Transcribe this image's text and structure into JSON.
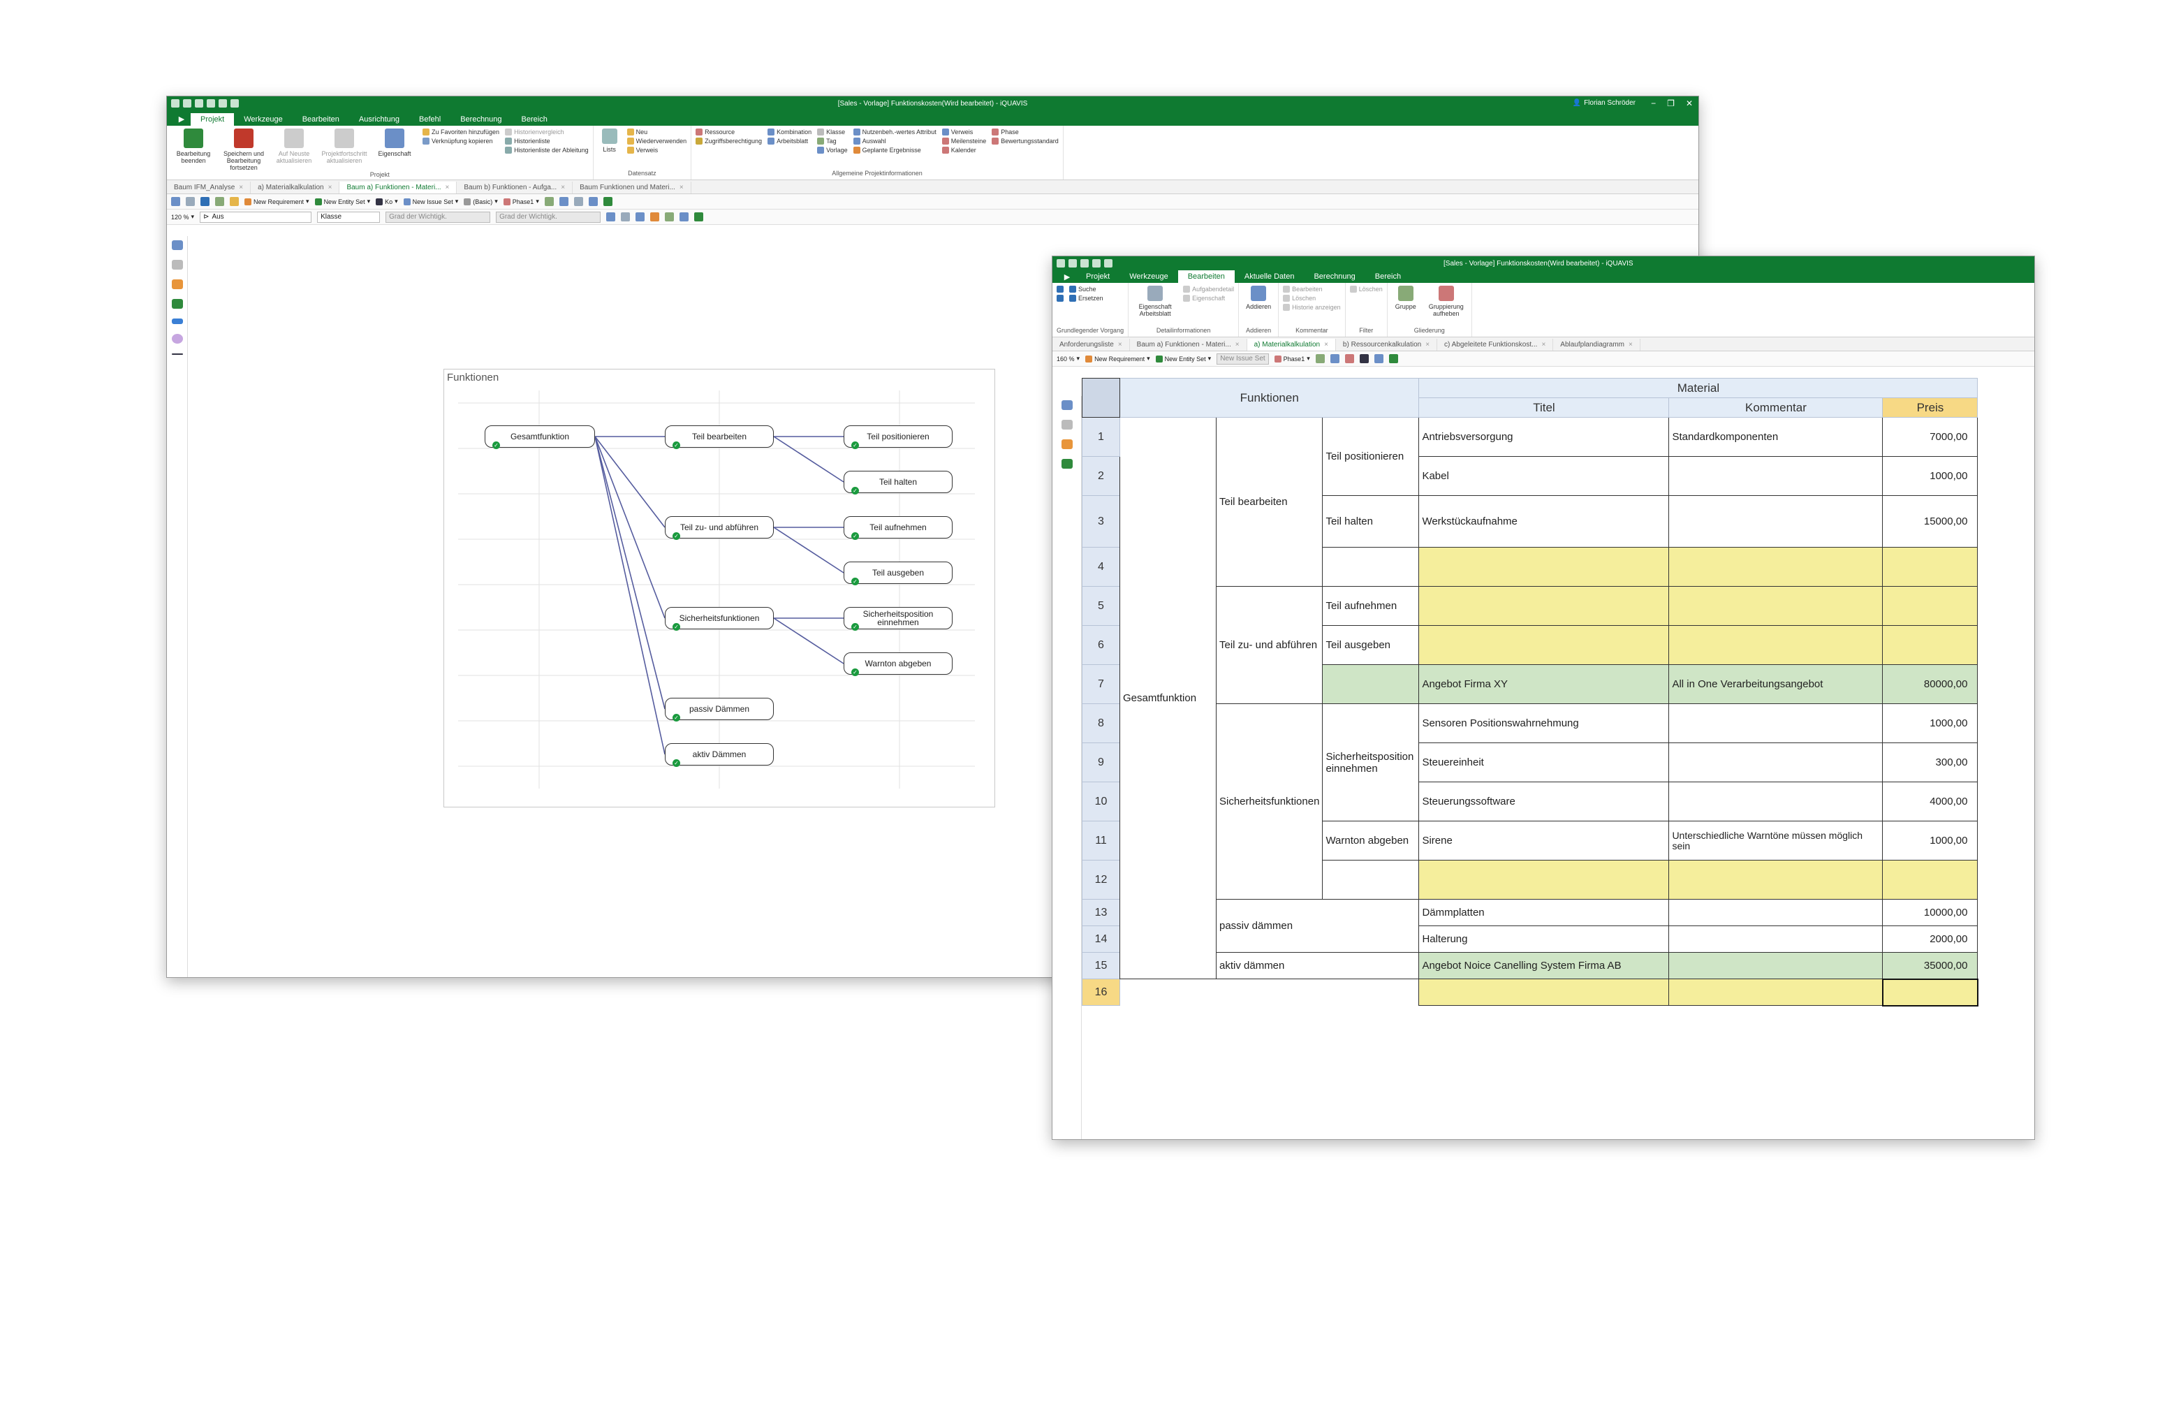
{
  "window1": {
    "title": "[Sales - Vorlage] Funktionskosten(Wird bearbeitet) - iQUAVIS",
    "user": "Florian Schröder",
    "menu": [
      "Projekt",
      "Werkzeuge",
      "Bearbeiten",
      "Ausrichtung",
      "Befehl",
      "Berechnung",
      "Bereich"
    ],
    "active_menu": "Projekt",
    "ribbon": {
      "big_buttons": [
        "Bearbeitung beenden",
        "Speichern und Bearbeitung fortsetzen",
        "Auf Neuste aktualisieren",
        "Projektfortschritt aktualisieren",
        "Eigenschaft"
      ],
      "group_projekt": "Projekt",
      "col1": [
        "Zu Favoriten hinzufügen",
        "Verknüpfung kopieren"
      ],
      "col2": [
        "Historienvergleich",
        "Historienliste",
        "Historienliste der Ableitung"
      ],
      "lists": "Lists",
      "col3": [
        "Neu",
        "Wiederverwenden",
        "Verweis"
      ],
      "group_datensatz": "Datensatz",
      "col4": [
        "Ressource",
        "Zugriffsberechtigung"
      ],
      "col5": [
        "Kombination",
        "Arbeitsblatt"
      ],
      "col6": [
        "Klasse",
        "Tag",
        "Vorlage"
      ],
      "col7": [
        "Nutzenbeh.-wertes Attribut",
        "Auswahl",
        "Geplante Ergebnisse"
      ],
      "col8": [
        "Verweis",
        "Meilensteine",
        "Kalender"
      ],
      "col9": [
        "Phase",
        "Bewertungsstandard"
      ],
      "group_allg": "Allgemeine Projektinformationen"
    },
    "tabs": [
      "Baum IFM_Analyse",
      "a) Materialkalkulation",
      "Baum a) Funktionen - Materi...",
      "Baum b) Funktionen - Aufga...",
      "Baum Funktionen und Materi..."
    ],
    "active_tab": 2,
    "toolbar1": {
      "req": "New Requirement",
      "entity": "New Entity Set",
      "k": "Ko",
      "issue": "New Issue Set",
      "basic": "(Basic)",
      "phase": "Phase1"
    },
    "toolbar2": {
      "zoom": "120 %",
      "aus": "Aus",
      "klasse": "Klasse",
      "grad1": "Grad der Wichtigk.",
      "grad2": "Grad der Wichtigk."
    },
    "diagram": {
      "title": "Funktionen",
      "nodes": {
        "gesamt": "Gesamtfunktion",
        "bearb": "Teil bearbeiten",
        "zuab": "Teil zu- und abführen",
        "sicher": "Sicherheitsfunktionen",
        "passiv": "passiv Dämmen",
        "aktiv": "aktiv Dämmen",
        "pos": "Teil positionieren",
        "halten": "Teil halten",
        "aufn": "Teil aufnehmen",
        "ausg": "Teil ausgeben",
        "sipos": "Sicherheitsposition einnehmen",
        "warn": "Warnton abgeben"
      }
    }
  },
  "window2": {
    "title": "[Sales - Vorlage] Funktionskosten(Wird bearbeitet) - iQUAVIS",
    "menu": [
      "Projekt",
      "Werkzeuge",
      "Bearbeiten",
      "Aktuelle Daten",
      "Berechnung",
      "Bereich"
    ],
    "active_menu": "Bearbeiten",
    "ribbon": {
      "g1_items": [
        "Suche",
        "Ersetzen"
      ],
      "g1_label": "Grundlegender Vorgang",
      "g2_big": "Eigenschaft Arbeitsblatt",
      "g2_items": [
        "Aufgabendetail",
        "Eigenschaft"
      ],
      "g2_label": "Detailinformationen",
      "g3_big": "Addieren",
      "g3_label": "Addieren",
      "g4_items": [
        "Bearbeiten",
        "Löschen",
        "Historie anzeigen"
      ],
      "g4_label": "Kommentar",
      "g5_items": [
        "Löschen"
      ],
      "g5_label": "Filter",
      "g6_big1": "Gruppe",
      "g6_big2": "Gruppierung aufheben",
      "g6_label": "Gliederung"
    },
    "tabs": [
      "Anforderungsliste",
      "Baum a) Funktionen - Materi...",
      "a) Materialkalkulation",
      "b) Ressourcenkalkulation",
      "c) Abgeleitete Funktionskost...",
      "Ablaufplandiagramm"
    ],
    "active_tab": 2,
    "toolbar": {
      "zoom": "160 %",
      "req": "New Requirement",
      "entity": "New Entity Set",
      "issue": "New Issue Set",
      "phase": "Phase1"
    },
    "grid": {
      "h_funktionen": "Funktionen",
      "h_material": "Material",
      "h_titel": "Titel",
      "h_kommentar": "Kommentar",
      "h_preis": "Preis",
      "f1": "Gesamtfunktion",
      "f2": [
        "Teil bearbeiten",
        "Teil zu- und abführen",
        "Sicherheitsfunktionen",
        "passiv dämmen",
        "aktiv dämmen"
      ],
      "f3": [
        "Teil positionieren",
        "Teil halten",
        "Teil aufnehmen",
        "Teil ausgeben",
        "Sicherheitsposition einnehmen",
        "Warnton abgeben"
      ],
      "rows": [
        {
          "n": "1",
          "t": "Antriebsversorgung",
          "k": "Standardkomponenten",
          "p": "7000,00"
        },
        {
          "n": "2",
          "t": "Kabel",
          "k": "",
          "p": "1000,00"
        },
        {
          "n": "3",
          "t": "Werkstückaufnahme",
          "k": "",
          "p": "15000,00"
        },
        {
          "n": "4",
          "t": "",
          "k": "",
          "p": ""
        },
        {
          "n": "5",
          "t": "",
          "k": "",
          "p": ""
        },
        {
          "n": "6",
          "t": "",
          "k": "",
          "p": ""
        },
        {
          "n": "7",
          "t": "Angebot Firma XY",
          "k": "All in One Verarbeitungsangebot",
          "p": "80000,00"
        },
        {
          "n": "8",
          "t": "Sensoren Positionswahrnehmung",
          "k": "",
          "p": "1000,00"
        },
        {
          "n": "9",
          "t": "Steuereinheit",
          "k": "",
          "p": "300,00"
        },
        {
          "n": "10",
          "t": "Steuerungssoftware",
          "k": "",
          "p": "4000,00"
        },
        {
          "n": "11",
          "t": "Sirene",
          "k": "Unterschiedliche Warntöne müssen möglich sein",
          "p": "1000,00"
        },
        {
          "n": "12",
          "t": "",
          "k": "",
          "p": ""
        },
        {
          "n": "13",
          "t": "Dämmplatten",
          "k": "",
          "p": "10000,00"
        },
        {
          "n": "14",
          "t": "Halterung",
          "k": "",
          "p": "2000,00"
        },
        {
          "n": "15",
          "t": "Angebot Noice Canelling System Firma AB",
          "k": "",
          "p": "35000,00"
        },
        {
          "n": "16",
          "t": "",
          "k": "",
          "p": ""
        }
      ]
    }
  },
  "colors": {
    "brand": "#0f7a31",
    "yellow": "#f5ee9c",
    "green": "#cfe5c6",
    "header": "#e3ecf7",
    "price_header": "#f7d985"
  }
}
